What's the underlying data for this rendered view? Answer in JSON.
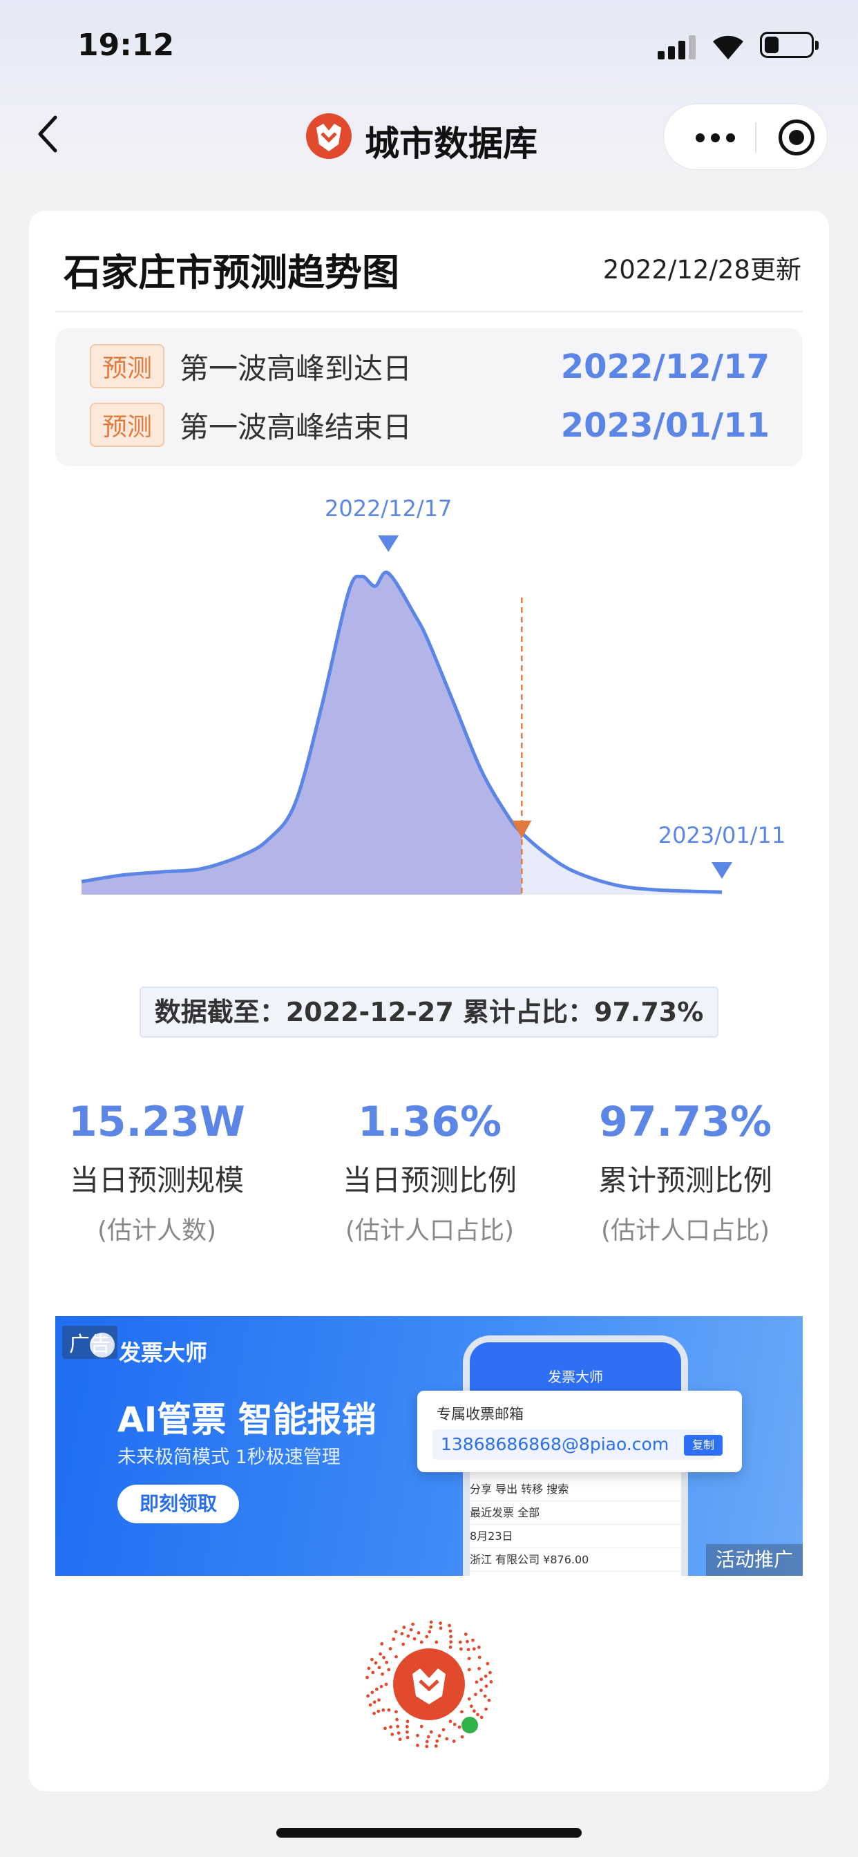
{
  "status_bar": {
    "time": "19:12"
  },
  "nav": {
    "title": "城市数据库"
  },
  "card": {
    "title": "石家庄市预测趋势图",
    "updated": "2022/12/28更新"
  },
  "predictions": [
    {
      "tag": "预测",
      "label": "第一波高峰到达日",
      "date": "2022/12/17"
    },
    {
      "tag": "预测",
      "label": "第一波高峰结束日",
      "date": "2023/01/11"
    }
  ],
  "chart_data": {
    "type": "area",
    "x_range": [
      "2022-11-24",
      "2023-01-11"
    ],
    "y_range": [
      0,
      100
    ],
    "peak_label": "2022/12/17",
    "end_label": "2023/01/11",
    "cutoff_date": "2022-12-27",
    "series": [
      {
        "values": [
          [
            "2022-11-24",
            4
          ],
          [
            "2022-11-27",
            6
          ],
          [
            "2022-11-30",
            7
          ],
          [
            "2022-12-03",
            8
          ],
          [
            "2022-12-06",
            12
          ],
          [
            "2022-12-08",
            17
          ],
          [
            "2022-12-10",
            28
          ],
          [
            "2022-12-12",
            58
          ],
          [
            "2022-12-14",
            93
          ],
          [
            "2022-12-15",
            98
          ],
          [
            "2022-12-16",
            95
          ],
          [
            "2022-12-17",
            99
          ],
          [
            "2022-12-19",
            86
          ],
          [
            "2022-12-20",
            78
          ],
          [
            "2022-12-22",
            58
          ],
          [
            "2022-12-24",
            38
          ],
          [
            "2022-12-26",
            24
          ],
          [
            "2022-12-27",
            19
          ],
          [
            "2022-12-29",
            12
          ],
          [
            "2022-12-31",
            7
          ],
          [
            "2023-01-03",
            3
          ],
          [
            "2023-01-06",
            1.5
          ],
          [
            "2023-01-11",
            0.8
          ]
        ]
      }
    ],
    "colors": {
      "line": "#5b86e5",
      "fill": "#b3b5e9",
      "fill_after_cutoff": "#e7ebfa",
      "cutoff_line": "#e07a3d"
    }
  },
  "data_cutoff": "数据截至：2022-12-27   累计占比：97.73%",
  "stats": [
    {
      "value": "15.23W",
      "label": "当日预测规模",
      "sub": "(估计人数)"
    },
    {
      "value": "1.36%",
      "label": "当日预测比例",
      "sub": "(估计人口占比)"
    },
    {
      "value": "97.73%",
      "label": "累计预测比例",
      "sub": "(估计人口占比)"
    }
  ],
  "ad": {
    "badge": "广告",
    "brand": "发票大师",
    "headline": "AI管票 智能报销",
    "subline": "未来极简模式 1秒极速管理",
    "cta": "即刻领取",
    "phone_title": "发票大师",
    "popup_title": "专属收票邮箱",
    "email": "13868686868@8piao.com",
    "copy": "复制",
    "list": [
      "分享  导出  转移  搜索",
      "最近发票                全部",
      "8月23日",
      "浙江          有限公司   ¥876.00"
    ],
    "promo": "活动推广"
  }
}
